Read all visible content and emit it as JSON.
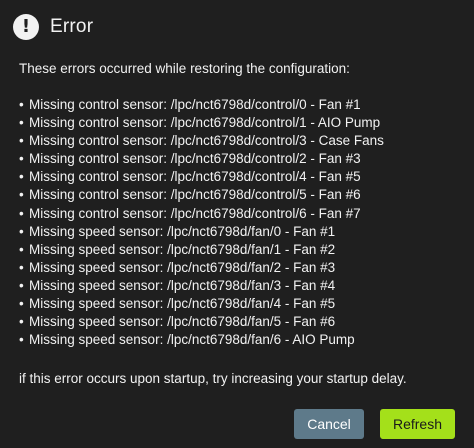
{
  "dialog": {
    "title": "Error",
    "icon": "exclamation-icon",
    "intro": "These errors occurred while restoring the configuration:",
    "bullet": "•",
    "errors": [
      "Missing control sensor: /lpc/nct6798d/control/0 - Fan #1",
      "Missing control sensor: /lpc/nct6798d/control/1 - AIO Pump",
      "Missing control sensor: /lpc/nct6798d/control/3 - Case Fans",
      "Missing control sensor: /lpc/nct6798d/control/2 - Fan #3",
      "Missing control sensor: /lpc/nct6798d/control/4 - Fan #5",
      "Missing control sensor: /lpc/nct6798d/control/5 - Fan #6",
      "Missing control sensor: /lpc/nct6798d/control/6 - Fan #7",
      "Missing speed sensor: /lpc/nct6798d/fan/0 - Fan #1",
      "Missing speed sensor: /lpc/nct6798d/fan/1 - Fan #2",
      "Missing speed sensor: /lpc/nct6798d/fan/2 - Fan #3",
      "Missing speed sensor: /lpc/nct6798d/fan/3 - Fan #4",
      "Missing speed sensor: /lpc/nct6798d/fan/4 - Fan #5",
      "Missing speed sensor: /lpc/nct6798d/fan/5 - Fan #6",
      "Missing speed sensor: /lpc/nct6798d/fan/6 - AIO Pump"
    ],
    "footer_note": "if this error occurs upon startup, try increasing your startup delay.",
    "buttons": {
      "cancel_label": "Cancel",
      "refresh_label": "Refresh"
    }
  },
  "colors": {
    "background": "#1f1f1f",
    "text": "#f2f2f2",
    "cancel_button": "#5e7a8a",
    "refresh_button": "#a4e01a"
  }
}
